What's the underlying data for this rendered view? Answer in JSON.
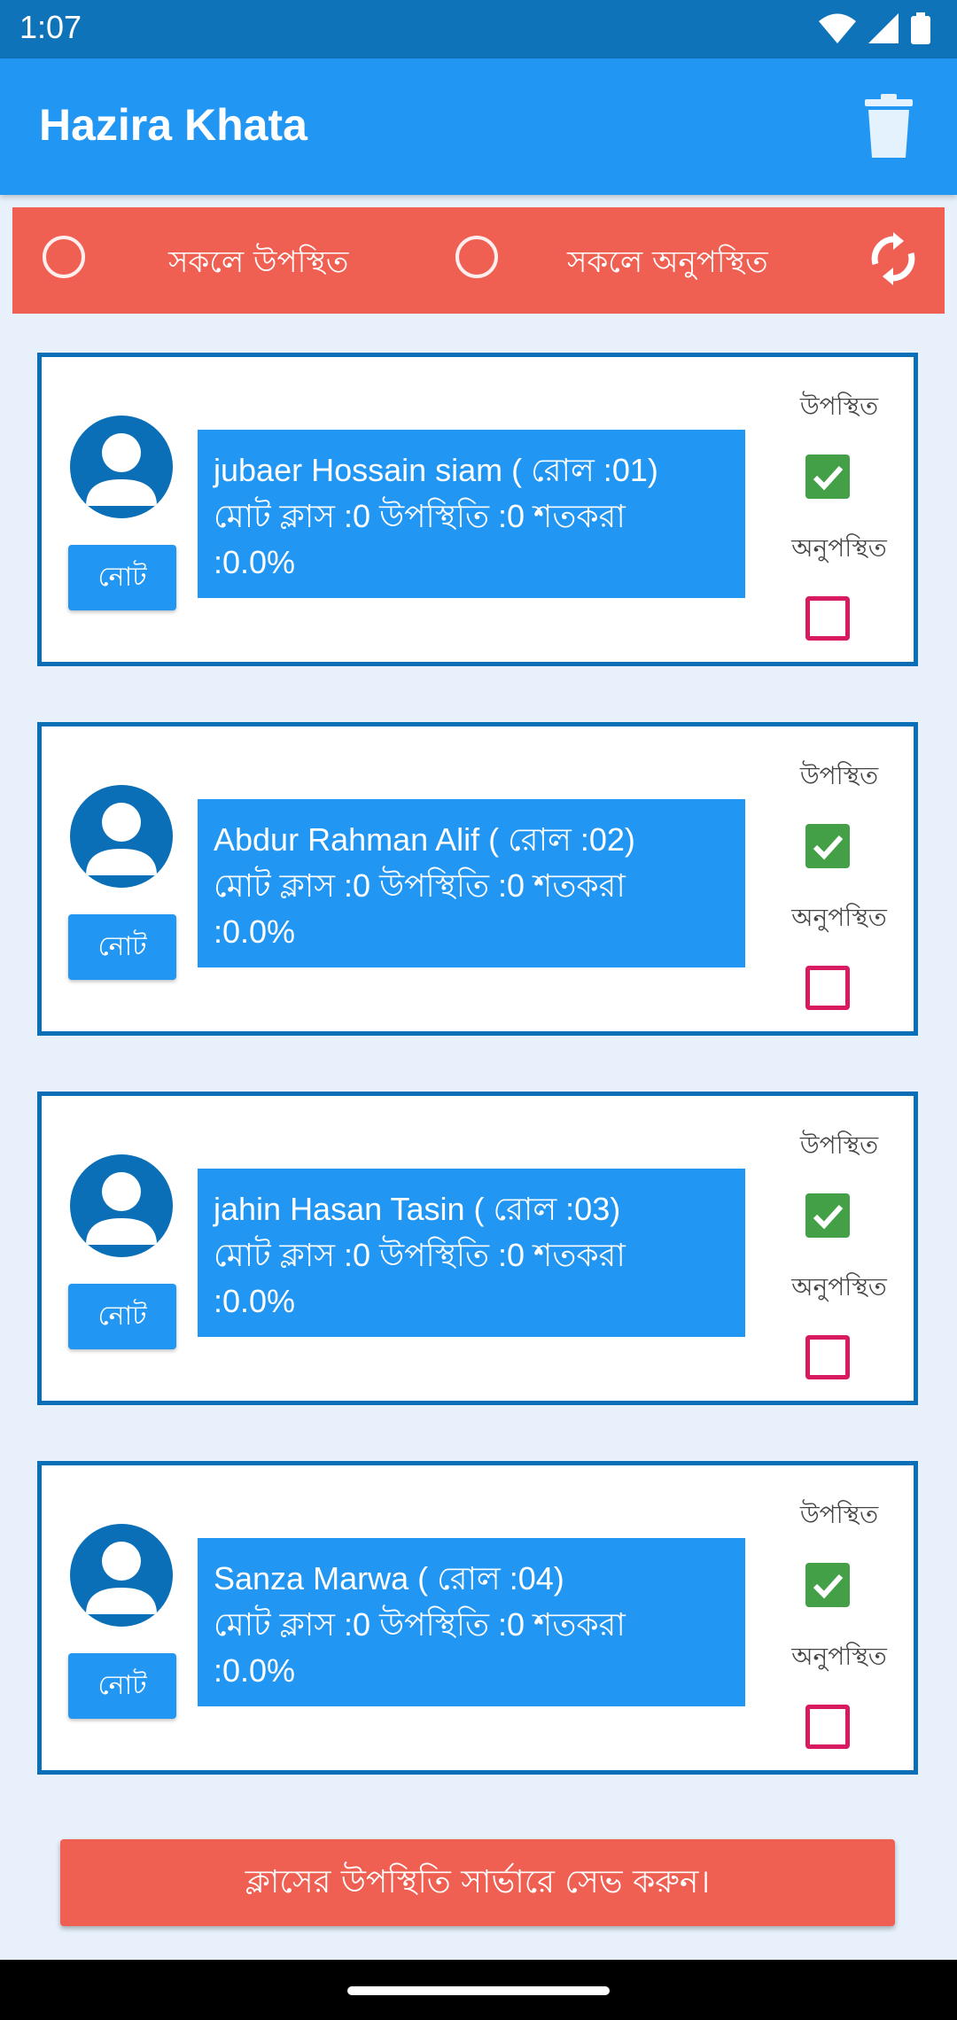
{
  "status": {
    "time": "1:07"
  },
  "appbar": {
    "title": "Hazira Khata"
  },
  "toggles": {
    "all_present": "সকলে উপস্থিত",
    "all_absent": "সকলে অনুপস্থিত"
  },
  "students": [
    {
      "line1": "jubaer Hossain siam ( রোল :01)",
      "line2": "মোট ক্লাস :0 উপস্থিতি :0 শতকরা",
      "line3": ":0.0%",
      "note": "নোট",
      "present_label": "উপস্থিত",
      "absent_label": "অনুপস্থিত",
      "present": true
    },
    {
      "line1": "Abdur Rahman Alif ( রোল :02)",
      "line2": "মোট ক্লাস :0 উপস্থিতি :0 শতকরা",
      "line3": ":0.0%",
      "note": "নোট",
      "present_label": "উপস্থিত",
      "absent_label": "অনুপস্থিত",
      "present": true
    },
    {
      "line1": "jahin Hasan Tasin ( রোল :03)",
      "line2": "মোট ক্লাস :0 উপস্থিতি :0 শতকরা",
      "line3": ":0.0%",
      "note": "নোট",
      "present_label": "উপস্থিত",
      "absent_label": "অনুপস্থিত",
      "present": true
    },
    {
      "line1": "Sanza Marwa ( রোল :04)",
      "line2": "মোট ক্লাস :0 উপস্থিতি :0 শতকরা",
      "line3": ":0.0%",
      "note": "নোট",
      "present_label": "উপস্থিত",
      "absent_label": "অনুপস্থিত",
      "present": true
    }
  ],
  "save_button": "ক্লাসের উপস্থিতি সার্ভারে সেভ করুন।",
  "colors": {
    "primary": "#2196f3",
    "accent": "#ef5f52",
    "dark": "#0b6fb8",
    "check": "#43a047",
    "uncheck": "#d81b60"
  }
}
